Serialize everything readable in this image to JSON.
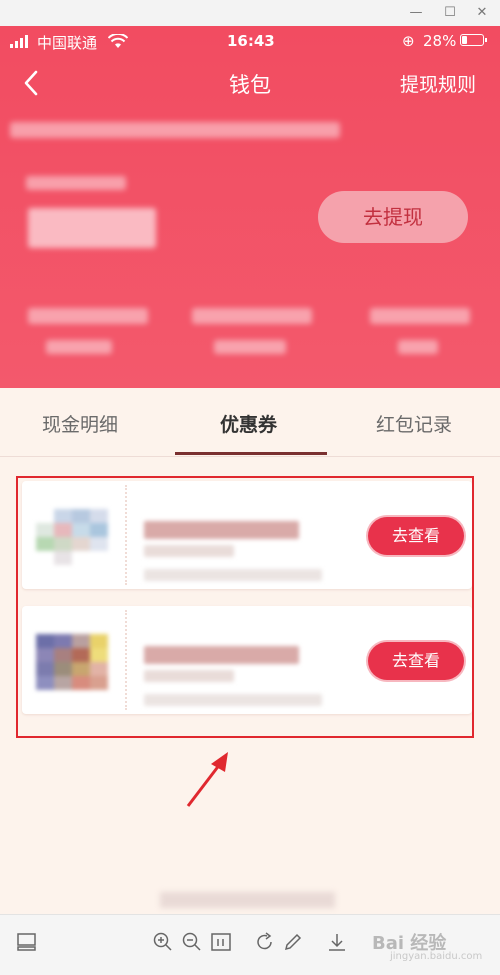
{
  "status_bar": {
    "carrier": "中国联通",
    "time": "16:43",
    "battery": "28%"
  },
  "nav": {
    "title": "钱包",
    "rules_link": "提现规则"
  },
  "wallet": {
    "withdraw_button": "去提现"
  },
  "tabs": [
    {
      "label": "现金明细",
      "active": false
    },
    {
      "label": "优惠券",
      "active": true
    },
    {
      "label": "红包记录",
      "active": false
    }
  ],
  "coupons": [
    {
      "button": "去查看"
    },
    {
      "button": "去查看"
    }
  ],
  "watermark": {
    "text": "Bai 经验",
    "sub": "jingyan.baidu.com"
  },
  "colors": {
    "header": "#f24c61",
    "accent": "#e8324b",
    "page_bg": "#fdf3ec",
    "highlight": "#e0282f"
  }
}
